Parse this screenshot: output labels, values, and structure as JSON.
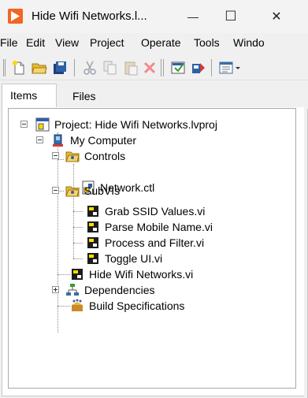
{
  "window": {
    "title": "Hide Wifi Networks.l...",
    "minimize_glyph": "—",
    "maximize_glyph": "☐",
    "close_glyph": "✕"
  },
  "menu": [
    "File",
    "Edit",
    "View",
    "Project",
    "Operate",
    "Tools",
    "Windo"
  ],
  "toolbar": {
    "icons": [
      "new-icon",
      "open-icon",
      "save-all-icon",
      "cut-icon",
      "copy-icon",
      "paste-icon",
      "delete-icon",
      "build-icon",
      "deploy-icon",
      "view-dropdown-icon"
    ]
  },
  "tabs": {
    "items": "Items",
    "files": "Files"
  },
  "tree": {
    "project": "Project: Hide Wifi Networks.lvproj",
    "my_computer": "My Computer",
    "controls": "Controls",
    "network_ctl": "Network.ctl",
    "subvis": "SubVIs",
    "grab_ssid": "Grab SSID Values.vi",
    "parse_mobile": "Parse Mobile Name.vi",
    "process_filter": "Process and Filter.vi",
    "toggle_ui": "Toggle UI.vi",
    "hide_wifi_vi": "Hide Wifi Networks.vi",
    "dependencies": "Dependencies",
    "build_specs": "Build Specifications"
  },
  "colors": {
    "app_icon": "#f26522",
    "folder": "#e8b83a",
    "vi_icon_dark": "#1c1c1c",
    "vi_icon_accent": "#ffde00"
  }
}
